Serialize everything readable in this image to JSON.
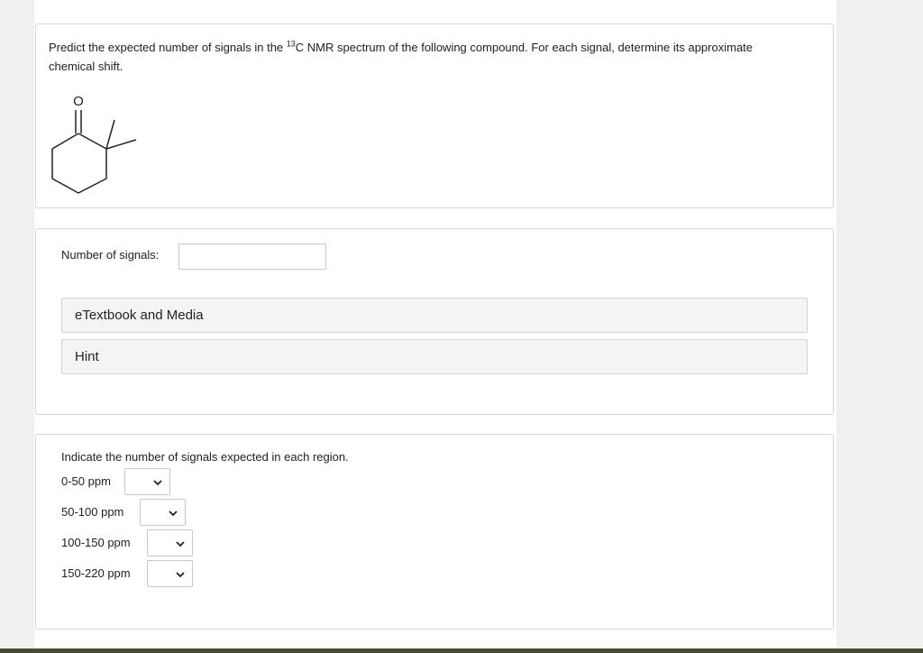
{
  "question": {
    "text_before": "Predict the expected number of signals in the ",
    "isotope_sup": "13",
    "text_after": "C NMR spectrum of the following compound. For each signal, determine its approximate chemical shift.",
    "molecule_oxygen_label": "O"
  },
  "answer": {
    "signals_label": "Number of signals:",
    "signals_value": "",
    "etextbook_label": "eTextbook and Media",
    "hint_label": "Hint"
  },
  "regions": {
    "title": "Indicate the number of signals expected in each region.",
    "rows": [
      {
        "label": "0-50 ppm",
        "value": ""
      },
      {
        "label": "50-100 ppm",
        "value": ""
      },
      {
        "label": "100-150 ppm",
        "value": ""
      },
      {
        "label": "150-220 ppm",
        "value": ""
      }
    ]
  },
  "icons": {
    "dropdown": "chevron-down-icon"
  },
  "colors": {
    "card_border": "#d6d6d6",
    "accordion_bg": "#f4f4f4",
    "page_bg": "#f0f0f0",
    "text": "#222222"
  }
}
